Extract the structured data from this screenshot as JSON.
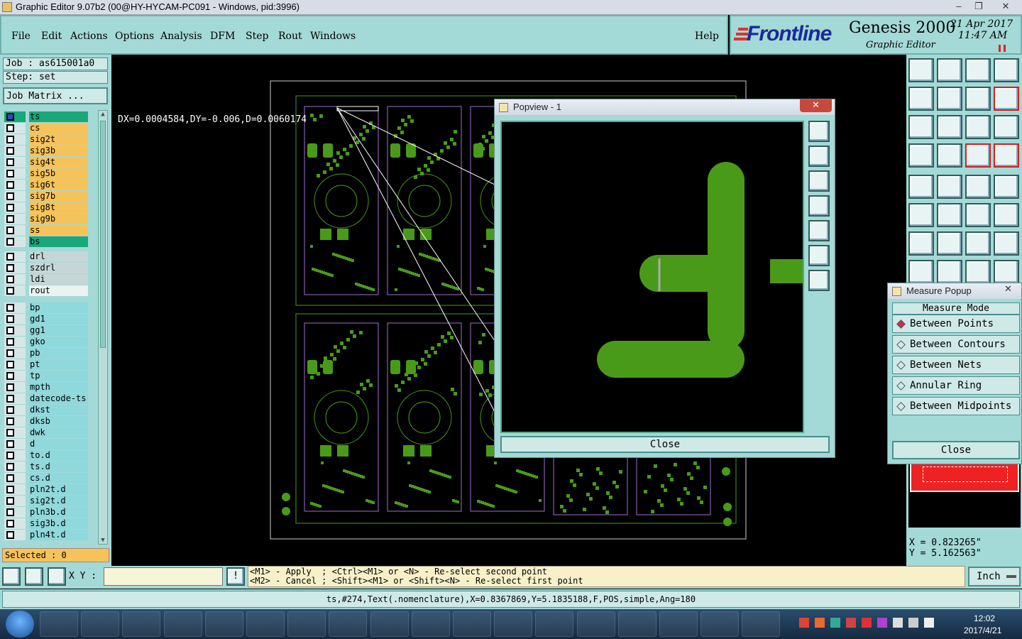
{
  "window": {
    "title": "Graphic Editor 9.07b2 (00@HY-HYCAM-PC091 - Windows, pid:3996)"
  },
  "menu": [
    "File",
    "Edit",
    "Actions",
    "Options",
    "Analysis",
    "DFM",
    "Step",
    "Rout",
    "Windows"
  ],
  "help": "Help",
  "brand": {
    "logo": "Frontline",
    "product": "Genesis 2000",
    "sub": "Graphic Editor",
    "date": "21 Apr 2017",
    "time": "11:47 AM"
  },
  "job": {
    "job": "Job : as615001a0",
    "step": "Step: set",
    "matrix": "Job Matrix ..."
  },
  "layers": {
    "board": [
      "ts",
      "cs",
      "sig2t",
      "sig3b",
      "sig4t",
      "sig5b",
      "sig6t",
      "sig7b",
      "sig8t",
      "sig9b",
      "ss",
      "bs"
    ],
    "drill": [
      "drl",
      "szdrl",
      "ldi",
      "rout"
    ],
    "misc": [
      "bp",
      "gd1",
      "gg1",
      "gko",
      "pb",
      "pt",
      "tp",
      "mpth",
      "datecode-ts",
      "dkst",
      "dksb",
      "dwk",
      "d",
      "to.d",
      "ts.d",
      "cs.d",
      "pln2t.d",
      "sig2t.d",
      "pln3b.d",
      "sig3b.d",
      "pln4t.d"
    ]
  },
  "selected": "Selected : 0",
  "measure_readout": "DX=0.0004584,DY=-0.006,D=0.0060174",
  "popview": {
    "title": "Popview - 1",
    "close": "Close"
  },
  "measure_popup": {
    "title": "Measure Popup",
    "mode_label": "Measure Mode",
    "modes": [
      "Between Points",
      "Between Contours",
      "Between Nets",
      "Annular Ring",
      "Between Midpoints"
    ],
    "selected_mode": "Between Points",
    "close": "Close"
  },
  "coords": {
    "x": "X = 0.823265\"",
    "y": "Y = 5.162563\""
  },
  "status": {
    "xy_label": "X Y :",
    "line1": "<M1> - Apply  ; <Ctrl><M1> or <N> - Re-select second point",
    "line2": "<M2> - Cancel ; <Shift><M1> or <Shift><N> - Re-select first point",
    "units": "Inch"
  },
  "info": "ts,#274,Text(.nomenclature),X=0.8367869,Y=5.1835188,F,POS,simple,Ang=180",
  "taskbar": {
    "time": "12:02",
    "date": "2017/4/21"
  },
  "colors": {
    "panel": "#a3d9d6",
    "copper": "#4a9a1a",
    "outline": "#a070d0",
    "sig": "#f6c35a",
    "selected": "#1aa77a"
  }
}
